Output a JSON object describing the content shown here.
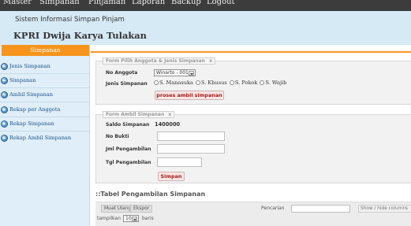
{
  "topnav": {
    "items": [
      "Master",
      "Simpanan",
      "Pinjaman",
      "Laporan",
      "Backup",
      "Logout"
    ]
  },
  "header": {
    "subtitle": "Sistem Informasi Simpan Pinjam",
    "title": "KPRI Dwija Karya Tulakan"
  },
  "sidebar": {
    "heading": "Simpanan",
    "items": [
      {
        "label": "Jenis Simpanan",
        "icon": "bullet-icon"
      },
      {
        "label": "Simpanan",
        "icon": "bullet-icon"
      },
      {
        "label": "Ambil Simpanan",
        "icon": "bullet-icon"
      },
      {
        "label": "Rekap per Anggota",
        "icon": "bullet-icon"
      },
      {
        "label": "Rekap Simpanan",
        "icon": "bullet-icon"
      },
      {
        "label": "Rekap Ambil Simpanan",
        "icon": "bullet-icon"
      }
    ]
  },
  "form_pilih": {
    "legend": "Form Pilih Anggota & Jenis Simpanan",
    "close_glyph": "x",
    "anggota_label": "No Anggota",
    "anggota_value": "Winarto - 001",
    "jenis_label": "Jenis Simpanan",
    "jenis_options": [
      "S. Manasuka",
      "S. Khusus",
      "S. Pokok",
      "S. Wajib"
    ],
    "submit_label": "proses ambil simpanan"
  },
  "form_ambil": {
    "legend": "Form Ambil Simpanan",
    "close_glyph": "x",
    "saldo_label": "Saldo Simpanan",
    "saldo_value": "1400000",
    "bukti_label": "No Bukti",
    "jumlah_label": "Jml Pengambilan",
    "tanggal_label": "Tgl Pengambilan",
    "submit_label": "Simpan"
  },
  "table": {
    "title": "::Tabel Pengambilan Simpanan",
    "reload_label": "Muat Ulang",
    "export_label": "Ekspor",
    "search_label": "Pencarian",
    "showhide_label": "Show / hide columns",
    "show_label": "tampilkan",
    "page_size": "10",
    "rows_label": "baris"
  },
  "colors": {
    "accent_orange": "#f7941d",
    "header_bg": "#d6eaf6",
    "sidebar_bg": "#dfeef8",
    "menu_bg": "#3c3c3c",
    "button_text": "#9b1c1c"
  }
}
